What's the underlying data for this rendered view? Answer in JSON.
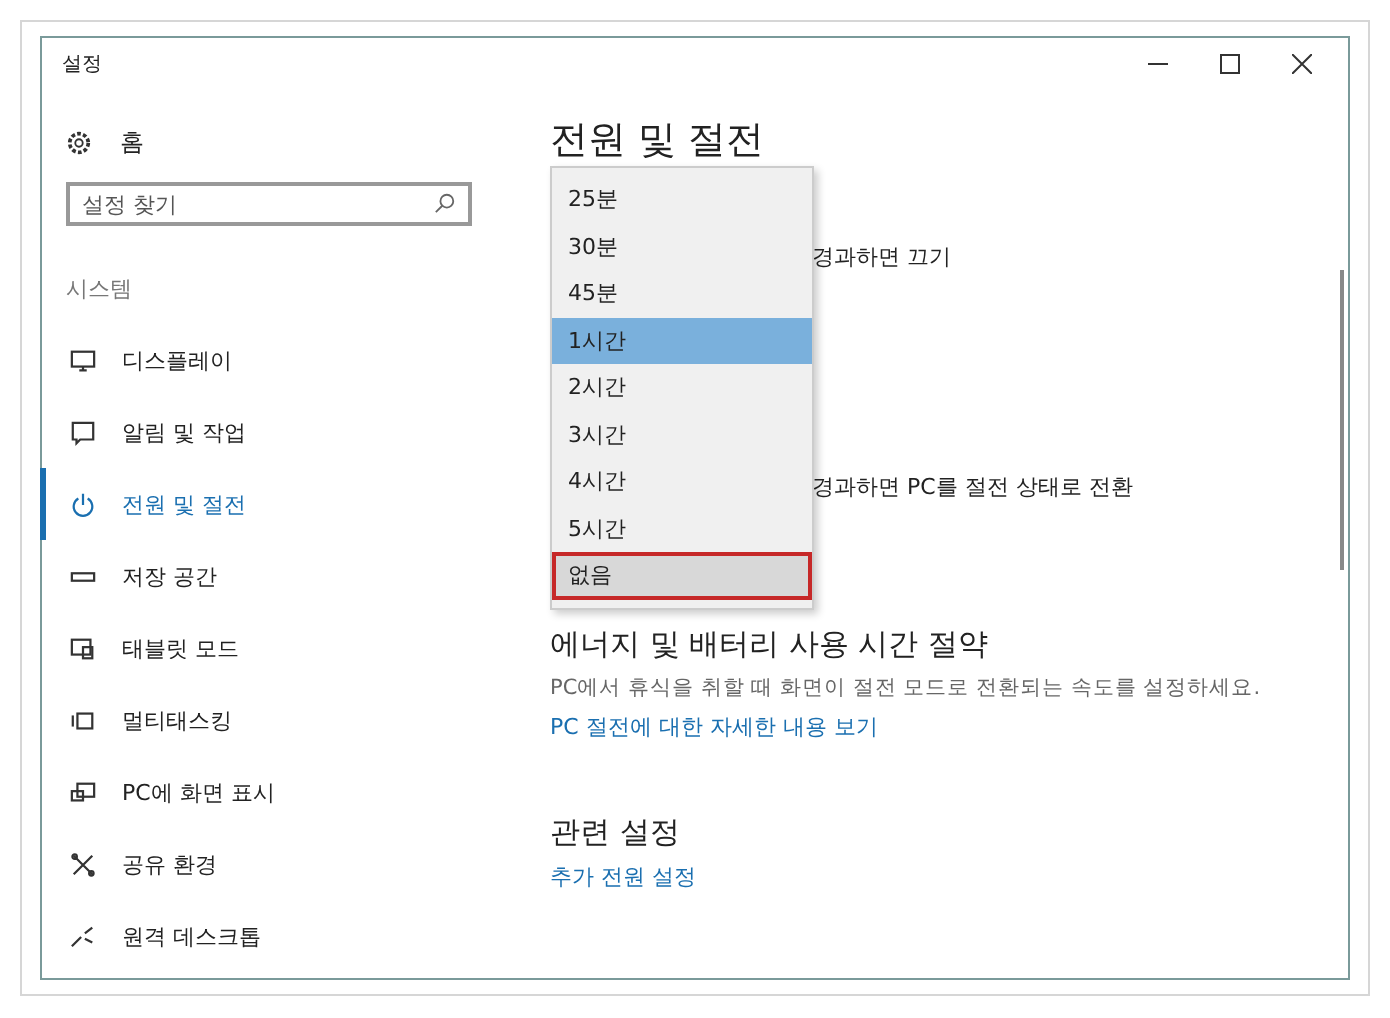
{
  "window": {
    "title": "설정"
  },
  "sidebar": {
    "home": "홈",
    "search": {
      "placeholder": "설정 찾기"
    },
    "section": "시스템",
    "items": [
      {
        "label": "디스플레이",
        "kind": "monitor",
        "selected": false
      },
      {
        "label": "알림 및 작업",
        "kind": "message",
        "selected": false
      },
      {
        "label": "전원 및 절전",
        "kind": "power",
        "selected": true
      },
      {
        "label": "저장 공간",
        "kind": "drive",
        "selected": false
      },
      {
        "label": "태블릿 모드",
        "kind": "tablet",
        "selected": false
      },
      {
        "label": "멀티태스킹",
        "kind": "multitask",
        "selected": false
      },
      {
        "label": "PC에 화면 표시",
        "kind": "project",
        "selected": false
      },
      {
        "label": "공유 환경",
        "kind": "share",
        "selected": false
      },
      {
        "label": "원격 데스크톱",
        "kind": "remote",
        "selected": false
      }
    ]
  },
  "page": {
    "title": "전원 및 절전",
    "obscured_texts": [
      "경과하면 끄기",
      "경과하면 PC를 절전 상태로 전환"
    ],
    "dropdown": [
      {
        "label": "25분",
        "selected": false,
        "outlined": false
      },
      {
        "label": "30분",
        "selected": false,
        "outlined": false
      },
      {
        "label": "45분",
        "selected": false,
        "outlined": false
      },
      {
        "label": "1시간",
        "selected": true,
        "outlined": false
      },
      {
        "label": "2시간",
        "selected": false,
        "outlined": false
      },
      {
        "label": "3시간",
        "selected": false,
        "outlined": false
      },
      {
        "label": "4시간",
        "selected": false,
        "outlined": false
      },
      {
        "label": "5시간",
        "selected": false,
        "outlined": false
      },
      {
        "label": "없음",
        "selected": false,
        "outlined": true
      }
    ],
    "sections": [
      {
        "heading": "에너지 및 배터리 사용 시간 절약",
        "description": "PC에서 휴식을 취할 때 화면이 절전 모드로 전환되는 속도를 설정하세요.",
        "link": "PC 절전에 대한 자세한 내용 보기"
      },
      {
        "heading": "관련 설정",
        "link": "추가 전원 설정"
      }
    ]
  }
}
